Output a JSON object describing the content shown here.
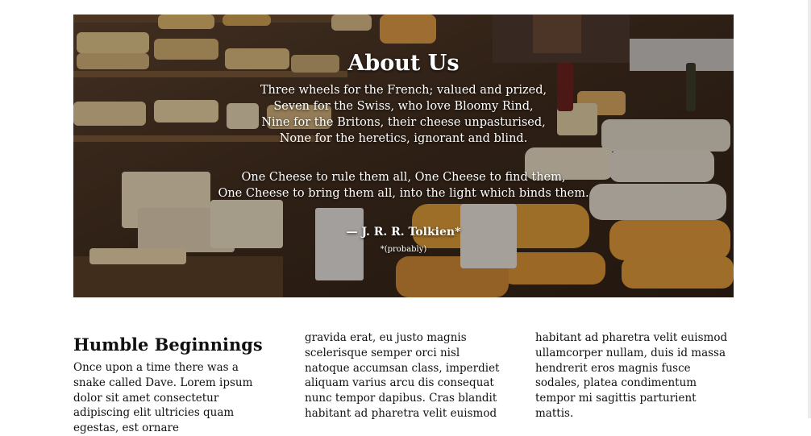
{
  "hero": {
    "title": "About Us",
    "poem_lines": [
      "Three wheels for the French; valued and prized,",
      "Seven for the Swiss, who love Bloomy Rind,",
      "Nine for the Britons, their cheese unpasturised,",
      "None for the heretics, ignorant and blind.",
      "One Cheese to rule them all, One Cheese to find them,",
      "One Cheese to bring them all, into the light which binds them."
    ],
    "attribution": "— J. R. R. Tolkien*",
    "footnote": "*(probably)"
  },
  "content": {
    "heading": "Humble Beginnings",
    "column_1": "Once upon a time there was a snake called Dave. Lorem ipsum dolor sit amet consectetur adipiscing elit ultricies quam egestas, est ornare",
    "column_2": "gravida erat, eu justo magnis scelerisque semper orci nisl natoque accumsan class, imperdiet aliquam varius arcu dis consequat nunc tempor dapibus. Cras blandit habitant ad pharetra velit euismod",
    "column_3": "habitant ad pharetra velit euismod ullamcorper nullam, duis id massa hendrerit eros magnis fusce sodales, platea condimentum tempor mi sagittis parturient mattis."
  }
}
